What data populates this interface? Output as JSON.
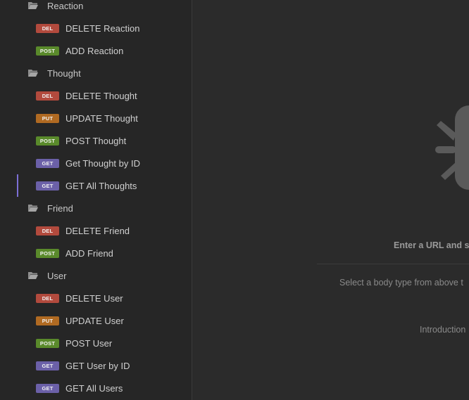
{
  "colors": {
    "del": "#b24a3d",
    "post": "#5a8a2b",
    "put": "#b06a22",
    "get": "#6b60a8",
    "active_accent": "#7c6fd6"
  },
  "sidebar": {
    "groups": [
      {
        "name": "Reaction",
        "icon": "folder-open-icon",
        "requests": [
          {
            "method": "DEL",
            "label": "DELETE Reaction"
          },
          {
            "method": "POST",
            "label": "ADD Reaction"
          }
        ]
      },
      {
        "name": "Thought",
        "icon": "folder-open-icon",
        "requests": [
          {
            "method": "DEL",
            "label": "DELETE Thought"
          },
          {
            "method": "PUT",
            "label": "UPDATE Thought"
          },
          {
            "method": "POST",
            "label": "POST Thought"
          },
          {
            "method": "GET",
            "label": "Get Thought by ID"
          },
          {
            "method": "GET",
            "label": "GET All Thoughts",
            "active": true
          }
        ]
      },
      {
        "name": "Friend",
        "icon": "folder-open-icon",
        "requests": [
          {
            "method": "DEL",
            "label": "DELETE Friend"
          },
          {
            "method": "POST",
            "label": "ADD Friend"
          }
        ]
      },
      {
        "name": "User",
        "icon": "folder-open-icon",
        "requests": [
          {
            "method": "DEL",
            "label": "DELETE User"
          },
          {
            "method": "PUT",
            "label": "UPDATE User"
          },
          {
            "method": "POST",
            "label": "POST User"
          },
          {
            "method": "GET",
            "label": "GET User by ID"
          },
          {
            "method": "GET",
            "label": "GET All Users"
          }
        ]
      }
    ]
  },
  "main": {
    "empty_icon": "bug-icon",
    "empty_title": "Enter a URL and s",
    "empty_subtitle": "Select a body type from above t",
    "intro_link": "Introduction"
  }
}
